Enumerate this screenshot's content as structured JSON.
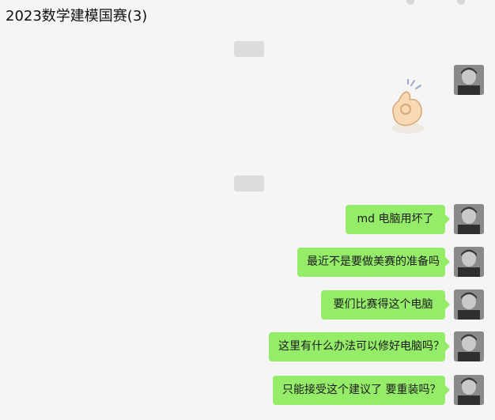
{
  "header": {
    "title": "2023数学建模国赛(3)"
  },
  "timestamps": [
    {
      "text": ""
    },
    {
      "text": ""
    }
  ],
  "messages": [
    {
      "type": "emoji",
      "emoji": "ok-hand"
    },
    {
      "type": "text",
      "text": "md 电脑用坏了"
    },
    {
      "type": "text",
      "text": "最近不是要做美赛的准备吗"
    },
    {
      "type": "text",
      "text": "要们比赛得这个电脑"
    },
    {
      "type": "text",
      "text": "这里有什么办法可以修好电脑吗？"
    },
    {
      "type": "text",
      "text": "只能接受这个建议了 要重装吗？"
    }
  ],
  "colors": {
    "background": "#f5f5f5",
    "bubble_self": "#95ec69",
    "timestamp_bg": "#dcdcdc"
  }
}
